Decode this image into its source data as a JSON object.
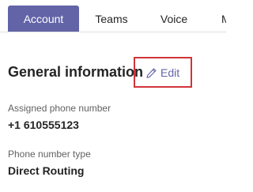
{
  "tabs": [
    {
      "label": "Account",
      "active": true
    },
    {
      "label": "Teams",
      "active": false
    },
    {
      "label": "Voice",
      "active": false
    },
    {
      "label": "M",
      "active": false
    }
  ],
  "section": {
    "title": "General information",
    "edit_label": "Edit",
    "edit_icon": "pencil-icon"
  },
  "fields": {
    "phone_label": "Assigned phone number",
    "phone_value": "+1 610555123",
    "type_label": "Phone number type",
    "type_value": "Direct Routing"
  },
  "colors": {
    "accent": "#6264a7",
    "highlight": "#d13438",
    "text": "#242424",
    "muted": "#616161"
  }
}
